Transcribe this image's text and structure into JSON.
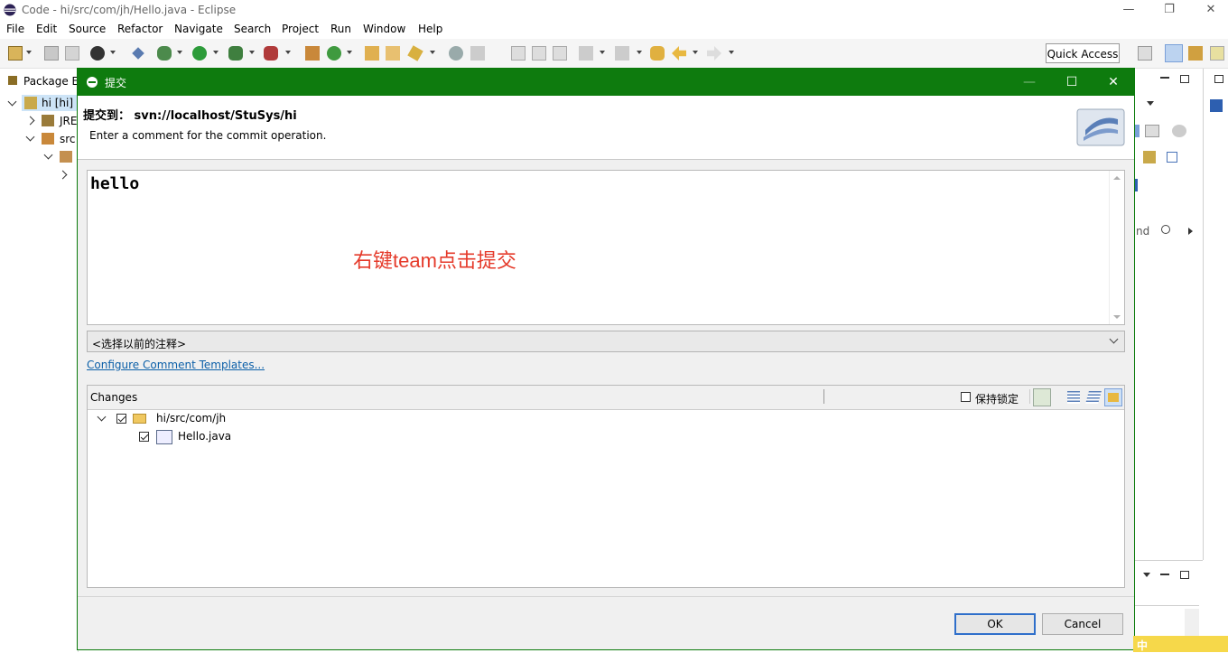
{
  "window": {
    "title": "Code - hi/src/com/jh/Hello.java - Eclipse"
  },
  "menu": [
    "File",
    "Edit",
    "Source",
    "Refactor",
    "Navigate",
    "Search",
    "Project",
    "Run",
    "Window",
    "Help"
  ],
  "toolbar": {
    "quick_access": "Quick Access"
  },
  "package_explorer": {
    "tab": "Package E",
    "items": [
      "hi [hi]",
      "JRE",
      "src"
    ]
  },
  "right_panel": {
    "search_hint": "nd"
  },
  "dialog": {
    "title": "提交",
    "header_title": "提交到： svn://localhost/StuSys/hi",
    "header_desc": "Enter a comment for the commit operation.",
    "comment_text": "hello",
    "annotation": "右键team点击提交",
    "previous_comments_placeholder": "<选择以前的注释>",
    "configure_link": "Configure Comment Templates...",
    "changes": {
      "label": "Changes",
      "keep_locks_label": "保持锁定",
      "keep_locks_checked": false,
      "tree": [
        {
          "label": "hi/src/com/jh",
          "checked": true,
          "type": "folder"
        },
        {
          "label": "Hello.java",
          "checked": true,
          "type": "file"
        }
      ]
    },
    "buttons": {
      "ok": "OK",
      "cancel": "Cancel"
    }
  },
  "ime": {
    "label": "中"
  }
}
